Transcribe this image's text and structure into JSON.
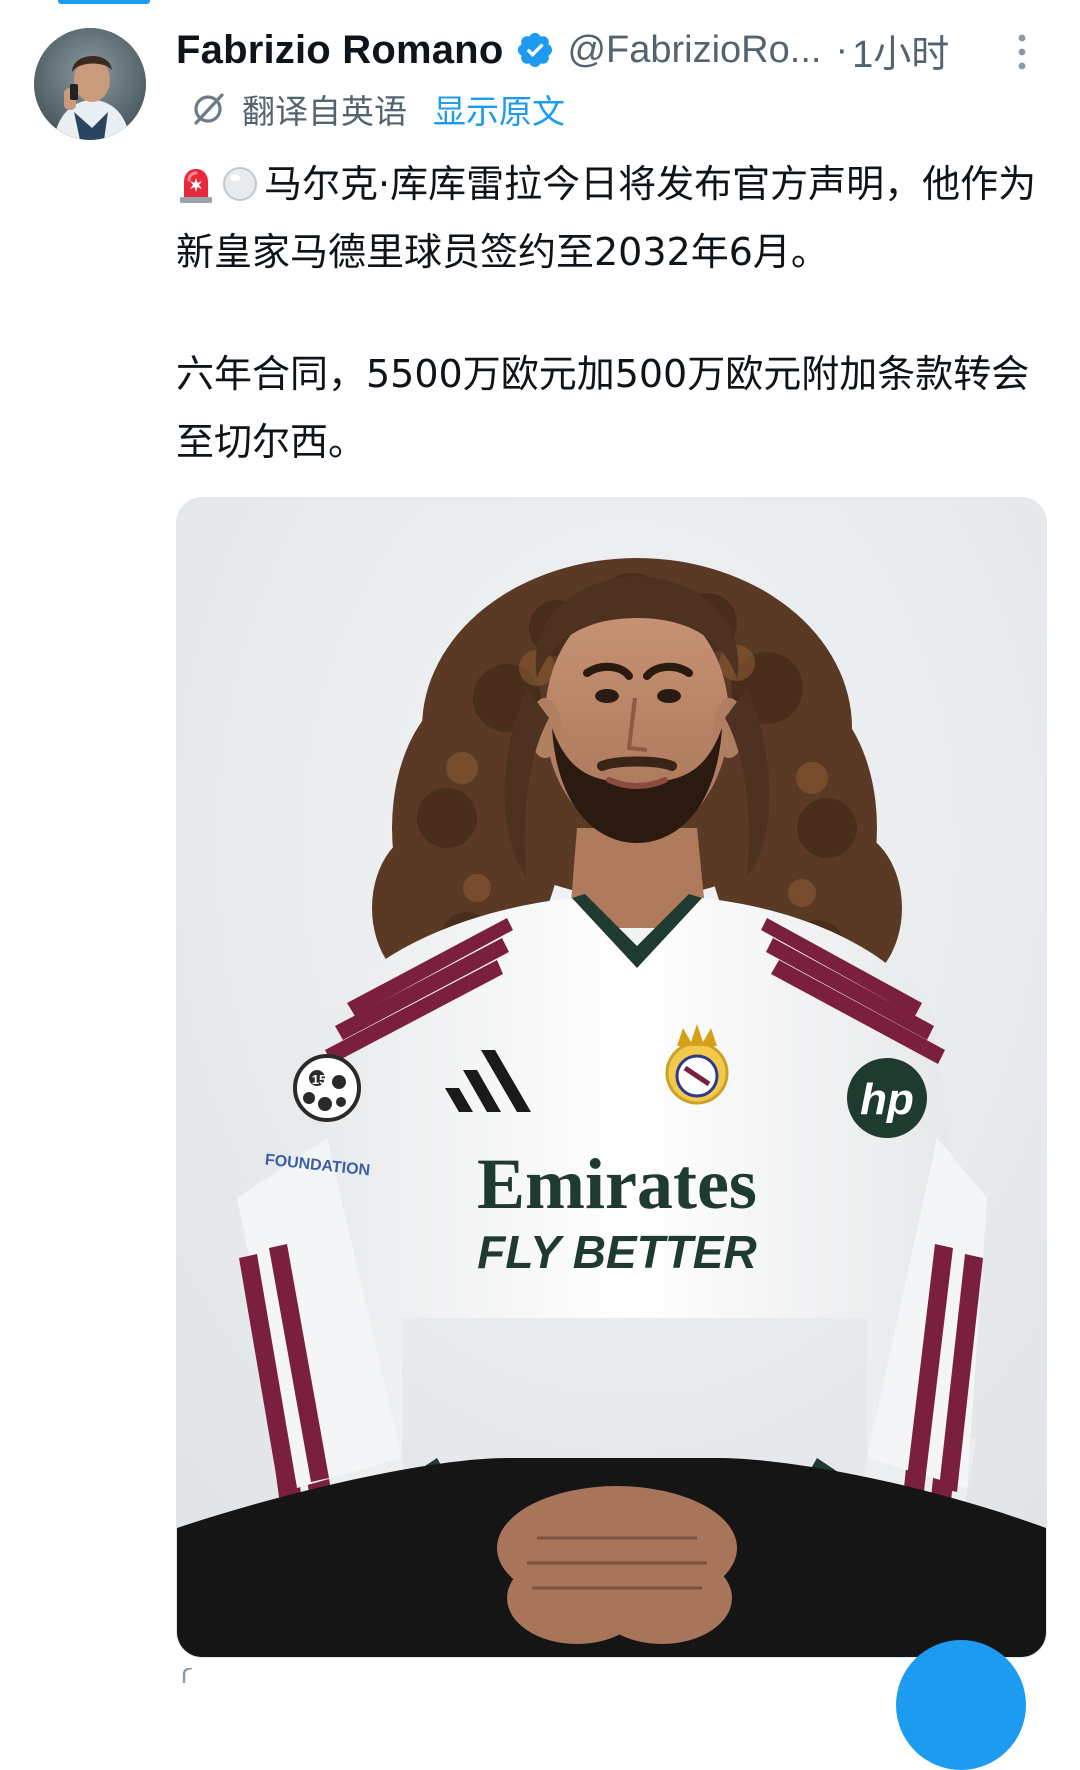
{
  "tweet": {
    "author": {
      "display_name": "Fabrizio Romano",
      "handle": "@FabrizioRo...",
      "verified": true,
      "avatar": "author-avatar"
    },
    "separator": "·",
    "timestamp": "1小时",
    "translation": {
      "label": "翻译自英语",
      "show_original": "显示原文",
      "icon": "translate-icon"
    },
    "paragraphs": [
      {
        "emojis": [
          "rotating-light-emoji",
          "white-circle-emoji"
        ],
        "text": "马尔克·库库雷拉今日将发布官方声明，他作为新皇家马德里球员签约至2032年6月。"
      },
      {
        "text": "六年合同，5500万欧元加500万欧元附加条款转会至切尔西。"
      }
    ],
    "media": {
      "type": "photo",
      "shirt_sponsor_line1": "Emirates",
      "shirt_sponsor_line2": "FLY BETTER",
      "sleeve_badge_text": "15",
      "sleeve_patch_text": "FOUNDATION",
      "sleeve_logo_text": "hp"
    },
    "more_icon": "more-vertical-icon",
    "verified_icon": "verified-badge-icon"
  },
  "colors": {
    "accent": "#1d9bf0",
    "text": "#0f1419",
    "muted": "#536471",
    "jersey_trim": "#7a1f3d"
  }
}
